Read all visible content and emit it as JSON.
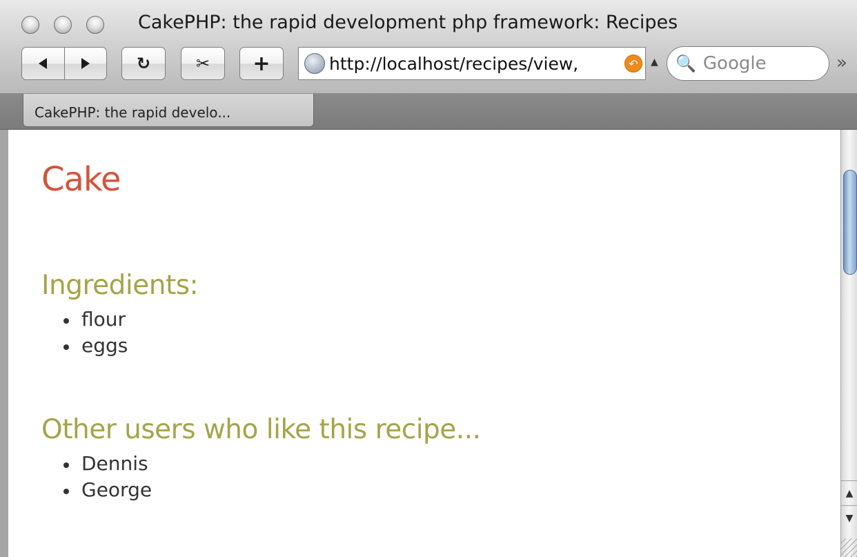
{
  "window": {
    "title": "CakePHP: the rapid development php framework: Recipes"
  },
  "toolbar": {
    "back_icon": "back-arrow-icon",
    "forward_icon": "forward-arrow-icon",
    "reload_glyph": "↻",
    "clip_glyph": "✂",
    "add_bookmark_glyph": "+",
    "url": "http://localhost/recipes/view,",
    "search_placeholder": "Google",
    "search_glyph": "🔍",
    "overflow_glyph": "»",
    "accent_color": "#f08a1c"
  },
  "tabs": [
    {
      "label": "CakePHP: the rapid develo..."
    }
  ],
  "page": {
    "title": "Cake",
    "title_color": "#d4533b",
    "heading_color": "#a5a44a",
    "ingredients_heading": "Ingredients:",
    "ingredients": [
      "flour",
      "eggs"
    ],
    "users_heading": "Other users who like this recipe...",
    "users": [
      "Dennis",
      "George"
    ]
  },
  "scrollbar": {
    "up_glyph": "▲",
    "down_glyph": "▼"
  }
}
